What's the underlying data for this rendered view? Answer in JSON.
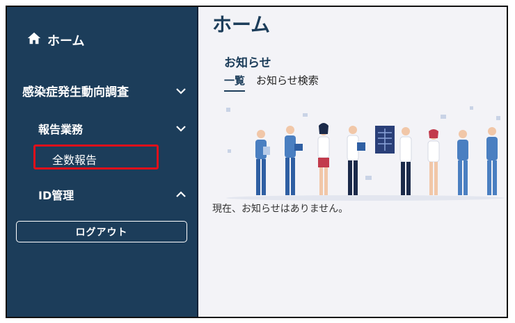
{
  "sidebar": {
    "home_label": "ホーム",
    "group_label": "感染症発生動向調査",
    "report_section_label": "報告業務",
    "all_reports_label": "全数報告",
    "id_management_label": "ID管理",
    "logout_label": "ログアウト",
    "icons": {
      "home": "home-icon",
      "group_chevron": "chevron-down-icon",
      "report_chevron": "chevron-down-icon",
      "id_chevron": "chevron-up-icon"
    }
  },
  "main": {
    "page_title": "ホーム",
    "notice_section_title": "お知らせ",
    "tabs": [
      {
        "label": "一覧",
        "active": true
      },
      {
        "label": "お知らせ検索",
        "active": false
      }
    ],
    "empty_message": "現在、お知らせはありません。"
  },
  "colors": {
    "sidebar_bg": "#1c3d5a",
    "highlight_border": "#e0101a",
    "main_bg": "#f3f3f7"
  }
}
